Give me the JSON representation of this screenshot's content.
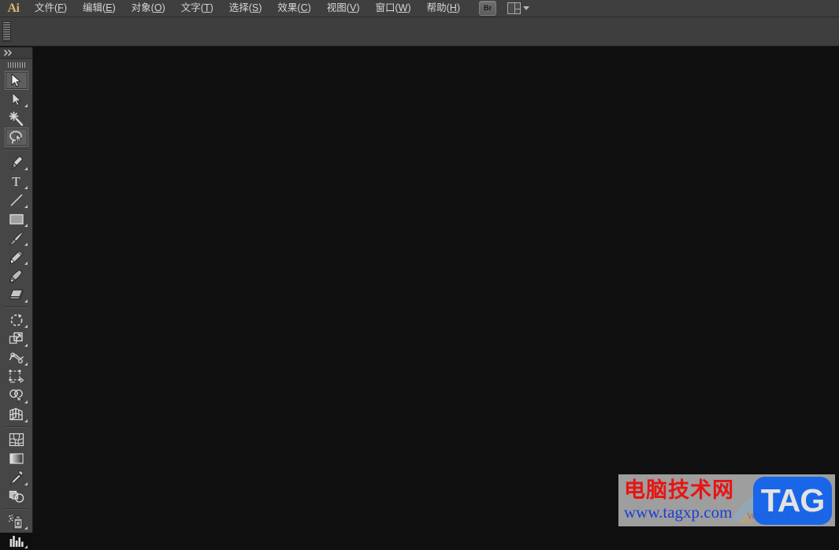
{
  "app": {
    "name": "Adobe Illustrator",
    "logo_text": "Ai"
  },
  "menubar": {
    "items": [
      {
        "name": "file",
        "label": "文件(F)",
        "pre": "文件(",
        "key": "F",
        "post": ")"
      },
      {
        "name": "edit",
        "label": "编辑(E)",
        "pre": "编辑(",
        "key": "E",
        "post": ")"
      },
      {
        "name": "object",
        "label": "对象(O)",
        "pre": "对象(",
        "key": "O",
        "post": ")"
      },
      {
        "name": "type",
        "label": "文字(T)",
        "pre": "文字(",
        "key": "T",
        "post": ")"
      },
      {
        "name": "select",
        "label": "选择(S)",
        "pre": "选择(",
        "key": "S",
        "post": ")"
      },
      {
        "name": "effect",
        "label": "效果(C)",
        "pre": "效果(",
        "key": "C",
        "post": ")"
      },
      {
        "name": "view",
        "label": "视图(V)",
        "pre": "视图(",
        "key": "V",
        "post": ")"
      },
      {
        "name": "window",
        "label": "窗口(W)",
        "pre": "窗口(",
        "key": "W",
        "post": ")"
      },
      {
        "name": "help",
        "label": "帮助(H)",
        "pre": "帮助(",
        "key": "H",
        "post": ")"
      }
    ],
    "bridge_button_label": "Br",
    "arrange_documents_label": ""
  },
  "control_bar": {
    "grip_label": ""
  },
  "toolbar": {
    "collapse_icon": "double-chevron-right",
    "tools": [
      {
        "name": "selection-tool",
        "icon": "arrow-solid",
        "active": true,
        "flyout": false
      },
      {
        "name": "direct-selection-tool",
        "icon": "arrow-direct",
        "active": false,
        "flyout": true
      },
      {
        "name": "magic-wand-tool",
        "icon": "magic-wand",
        "active": false,
        "flyout": false
      },
      {
        "name": "lasso-tool",
        "icon": "lasso",
        "active": true,
        "flyout": false
      },
      {
        "name": "pen-tool",
        "icon": "pen-nib",
        "active": false,
        "flyout": true
      },
      {
        "name": "type-tool",
        "icon": "type-T",
        "active": false,
        "flyout": true
      },
      {
        "name": "line-segment-tool",
        "icon": "line-diagonal",
        "active": false,
        "flyout": true
      },
      {
        "name": "rectangle-tool",
        "icon": "rectangle",
        "active": false,
        "flyout": true
      },
      {
        "name": "paintbrush-tool",
        "icon": "paintbrush",
        "active": false,
        "flyout": true
      },
      {
        "name": "pencil-tool",
        "icon": "pencil",
        "active": false,
        "flyout": true
      },
      {
        "name": "blob-brush-tool",
        "icon": "blob-brush",
        "active": false,
        "flyout": false
      },
      {
        "name": "eraser-tool",
        "icon": "eraser",
        "active": false,
        "flyout": true
      },
      {
        "name": "rotate-tool",
        "icon": "rotate",
        "active": false,
        "flyout": true
      },
      {
        "name": "scale-tool",
        "icon": "scale",
        "active": false,
        "flyout": true
      },
      {
        "name": "width-tool",
        "icon": "width-warp",
        "active": false,
        "flyout": true
      },
      {
        "name": "free-transform-tool",
        "icon": "free-transform",
        "active": false,
        "flyout": false
      },
      {
        "name": "shape-builder-tool",
        "icon": "shape-builder",
        "active": false,
        "flyout": true
      },
      {
        "name": "perspective-grid-tool",
        "icon": "perspective-grid",
        "active": false,
        "flyout": true
      },
      {
        "name": "mesh-tool",
        "icon": "mesh",
        "active": false,
        "flyout": false
      },
      {
        "name": "gradient-tool",
        "icon": "gradient",
        "active": false,
        "flyout": false
      },
      {
        "name": "eyedropper-tool",
        "icon": "eyedropper",
        "active": false,
        "flyout": true
      },
      {
        "name": "blend-tool",
        "icon": "blend",
        "active": false,
        "flyout": false
      },
      {
        "name": "symbol-sprayer-tool",
        "icon": "symbol-sprayer",
        "active": false,
        "flyout": true
      },
      {
        "name": "column-graph-tool",
        "icon": "bar-graph",
        "active": false,
        "flyout": true
      }
    ],
    "separators_after": [
      3,
      11,
      17,
      21
    ]
  },
  "canvas": {
    "background_color": "#101010",
    "document_open": false
  },
  "watermark": {
    "title": "电脑技术网",
    "url": "www.tagxp.com",
    "badge_text": "TAG",
    "ghost_text": "www.xz7.com",
    "title_color": "#e81414",
    "url_color": "#1a3fd4",
    "badge_color": "#1a66e8"
  },
  "colors": {
    "menubar_bg": "#3f3f3f",
    "controlbar_bg": "#3e3e3e",
    "toolbar_bg": "#464646",
    "canvas_bg": "#101010",
    "accent": "#d8b76a"
  }
}
